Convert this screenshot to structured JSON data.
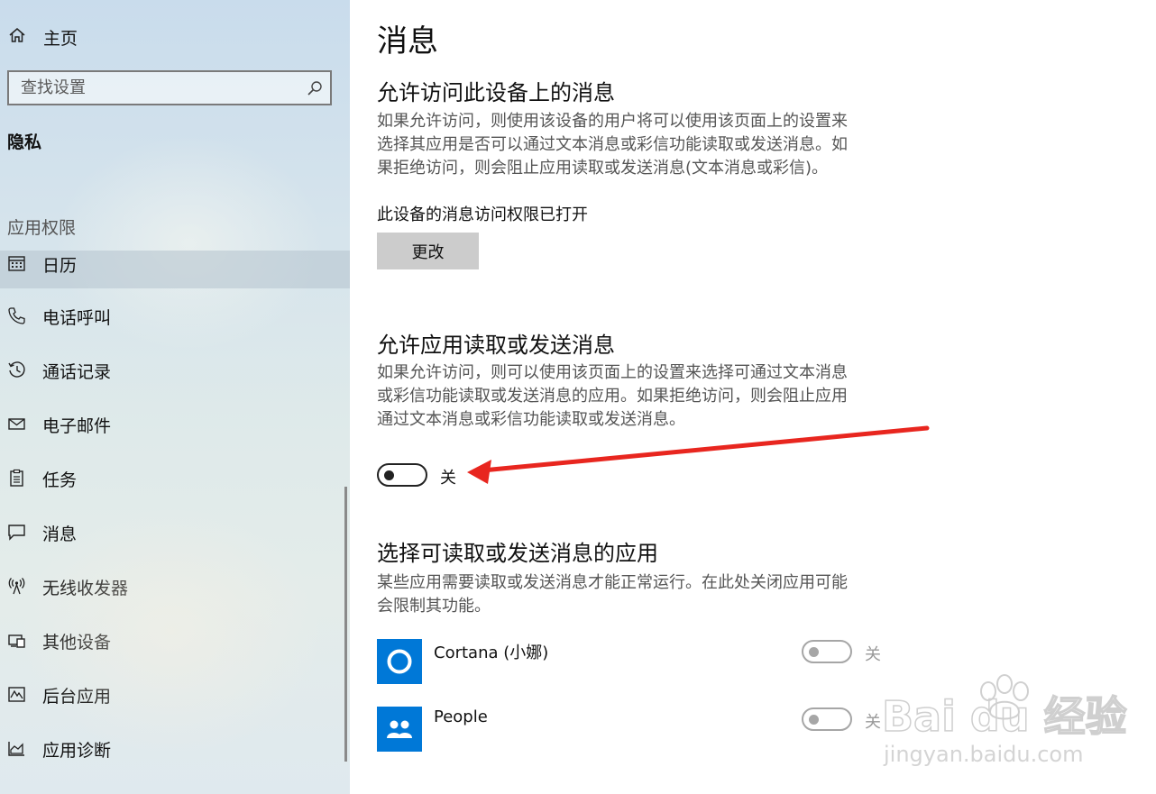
{
  "sidebar": {
    "home_label": "主页",
    "search_placeholder": "查找设置",
    "section_title": "隐私",
    "group_title": "应用权限",
    "items": [
      {
        "label": "日历",
        "icon": "calendar-icon"
      },
      {
        "label": "电话呼叫",
        "icon": "phone-icon"
      },
      {
        "label": "通话记录",
        "icon": "history-icon"
      },
      {
        "label": "电子邮件",
        "icon": "mail-icon"
      },
      {
        "label": "任务",
        "icon": "clipboard-icon"
      },
      {
        "label": "消息",
        "icon": "message-icon"
      },
      {
        "label": "无线收发器",
        "icon": "antenna-icon"
      },
      {
        "label": "其他设备",
        "icon": "devices-icon"
      },
      {
        "label": "后台应用",
        "icon": "activity-icon"
      },
      {
        "label": "应用诊断",
        "icon": "chart-icon"
      }
    ]
  },
  "main": {
    "page_title": "消息",
    "device_access": {
      "heading": "允许访问此设备上的消息",
      "desc_lines": [
        "如果允许访问，则使用该设备的用户将可以使用该页面上的设置来",
        "选择其应用是否可以通过文本消息或彩信功能读取或发送消息。如",
        "果拒绝访问，则会阻止应用读取或发送消息(文本消息或彩信)。"
      ],
      "status": "此设备的消息访问权限已打开",
      "button": "更改"
    },
    "app_access": {
      "heading": "允许应用读取或发送消息",
      "desc_lines": [
        "如果允许访问，则可以使用该页面上的设置来选择可通过文本消息",
        "或彩信功能读取或发送消息的应用。如果拒绝访问，则会阻止应用",
        "通过文本消息或彩信功能读取或发送消息。"
      ],
      "toggle_state": "关"
    },
    "choose_apps": {
      "heading": "选择可读取或发送消息的应用",
      "desc_lines": [
        "某些应用需要读取或发送消息才能正常运行。在此处关闭应用可能",
        "会限制其功能。"
      ],
      "apps": [
        {
          "name": "Cortana (小娜)",
          "state": "关",
          "icon": "cortana-icon"
        },
        {
          "name": "People",
          "state": "关",
          "icon": "people-icon"
        }
      ]
    }
  },
  "colors": {
    "accent": "#0078d7",
    "annotation_arrow": "#e8261f"
  },
  "watermark": {
    "text": "Bai du 经验",
    "url": "jingyan.baidu.com"
  }
}
